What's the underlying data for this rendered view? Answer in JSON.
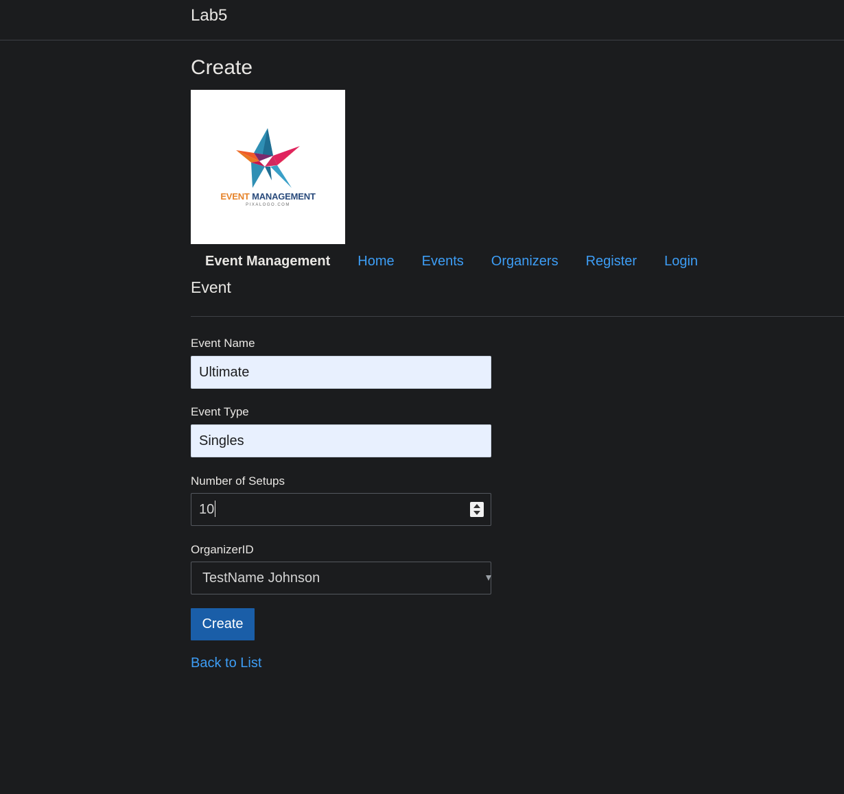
{
  "app": {
    "brand": "Lab5"
  },
  "page": {
    "title": "Create",
    "section": "Event"
  },
  "logo": {
    "word1": "EVENT",
    "word2": "MANAGEMENT",
    "sub": "PIXALOGO.COM"
  },
  "nav": {
    "brand": "Event Management",
    "links": [
      "Home",
      "Events",
      "Organizers",
      "Register",
      "Login"
    ]
  },
  "form": {
    "event_name": {
      "label": "Event Name",
      "value": "Ultimate"
    },
    "event_type": {
      "label": "Event Type",
      "value": "Singles"
    },
    "setups": {
      "label": "Number of Setups",
      "value": "10"
    },
    "organizer": {
      "label": "OrganizerID",
      "selected": "TestName Johnson"
    },
    "submit_label": "Create"
  },
  "back_link": "Back to List",
  "colors": {
    "background": "#1b1c1e",
    "link": "#3d9df5",
    "primary_button": "#1a5ea8",
    "autofill_bg": "#e8f0fe"
  }
}
